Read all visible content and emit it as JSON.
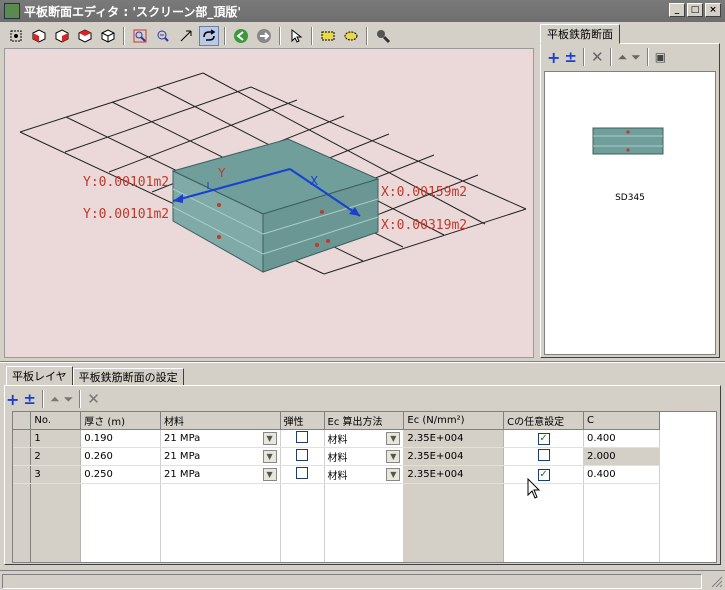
{
  "window": {
    "title": "平板断面エディタ : 'スクリーン部_頂版'",
    "buttons": [
      "_",
      "□",
      "×"
    ]
  },
  "viewport": {
    "axis_y_label": "Y",
    "axis_x_label": "X",
    "annotations": {
      "y_top": "Y:0.00101m2",
      "y_bottom": "Y:0.00101m2",
      "x_top": "X:0.00159m2",
      "x_bottom": "X:0.00319m2"
    }
  },
  "right_panel": {
    "tab_label": "平板鉄筋断面",
    "section_label": "SD345"
  },
  "bottom": {
    "tabs": [
      "平板レイヤ",
      "平板鉄筋断面の設定"
    ],
    "table": {
      "columns": [
        "No.",
        "厚さ (m)",
        "材料",
        "弾性",
        "Ec 算出方法",
        "Ec (N/mm²)",
        "Cの任意設定",
        "C"
      ],
      "rows": [
        {
          "no": "1",
          "thickness": "0.190",
          "material": "21 MPa",
          "elastic": false,
          "ec_method": "材料",
          "ec": "2.35E+004",
          "c_custom": true,
          "c": "0.400"
        },
        {
          "no": "2",
          "thickness": "0.260",
          "material": "21 MPa",
          "elastic": false,
          "ec_method": "材料",
          "ec": "2.35E+004",
          "c_custom": false,
          "c": "2.000"
        },
        {
          "no": "3",
          "thickness": "0.250",
          "material": "21 MPa",
          "elastic": false,
          "ec_method": "材料",
          "ec": "2.35E+004",
          "c_custom": true,
          "c": "0.400"
        }
      ]
    }
  },
  "colors": {
    "viewport_bg": "#ead9d8",
    "slab": "#6f9e9b",
    "annotation": "#c0392b",
    "axis": "#1a3fd1"
  }
}
